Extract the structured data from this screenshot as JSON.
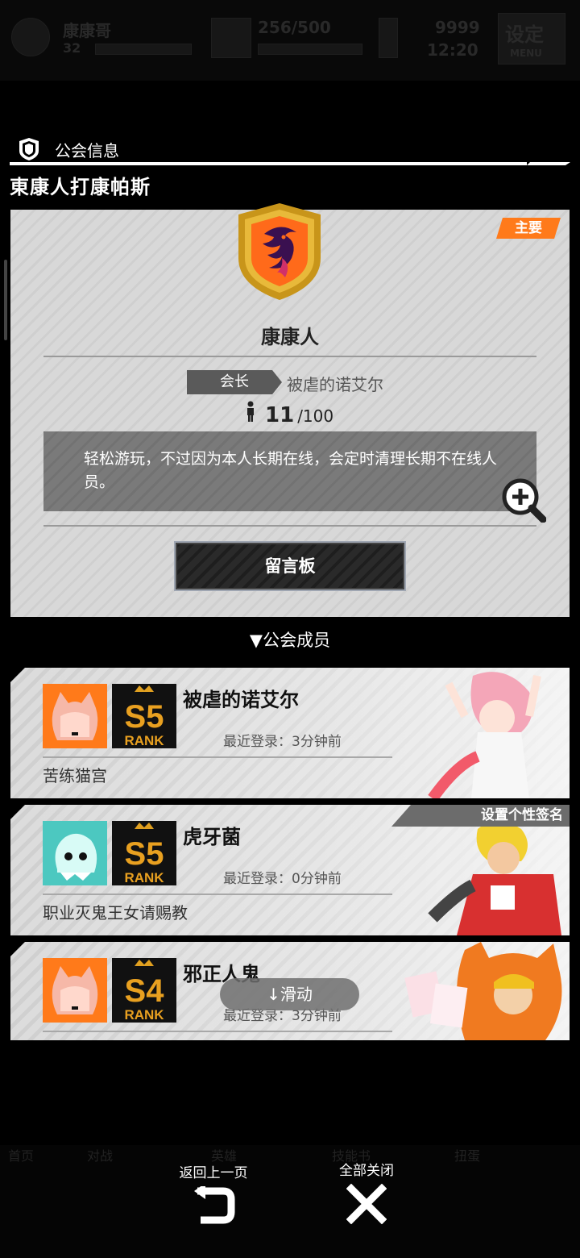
{
  "colors": {
    "accent_orange": "#ff7a1a",
    "gold": "#d39a1c",
    "card_bg": "#d8d8d8"
  },
  "background": {
    "top": {
      "player_name": "康康哥",
      "level": "32",
      "stamina": "256/500",
      "coins": "9999",
      "time": "12:20",
      "menu_label": "设定",
      "menu_sub": "MENU"
    },
    "bottom_tabs": [
      "首页",
      "对战",
      "英雄",
      "技能书",
      "扭蛋"
    ]
  },
  "header": {
    "section_title": "公会信息",
    "guild_full_name": "東康人打康帕斯"
  },
  "guild": {
    "badge_main": "主要",
    "name": "康康人",
    "leader_role": "会长",
    "leader_name": "被虐的诺艾尔",
    "member_count": "11",
    "member_max": "/100",
    "description": "轻松游玩，不过因为本人长期在线，会定时清理长期不在线人员。",
    "board_button": "留言板",
    "zoom_icon": "zoom-in-icon"
  },
  "members_section": {
    "title": "▼公会成员",
    "members": [
      {
        "name": "被虐的诺艾尔",
        "rank_label": "S5",
        "login": "最近登录：3分钟前",
        "signature": "苦练猫宫"
      },
      {
        "name": "虎牙菌",
        "rank_label": "S5",
        "login": "最近登录：0分钟前",
        "signature": "职业灭鬼王女请赐教",
        "banner": "设置个性签名"
      },
      {
        "name": "邪正人鬼",
        "rank_label": "S4",
        "login": "最近登录：3分钟前",
        "signature": ""
      }
    ],
    "scroll_hint": "↓滑动"
  },
  "footer": {
    "back_label": "返回上一页",
    "close_label": "全部关闭"
  }
}
